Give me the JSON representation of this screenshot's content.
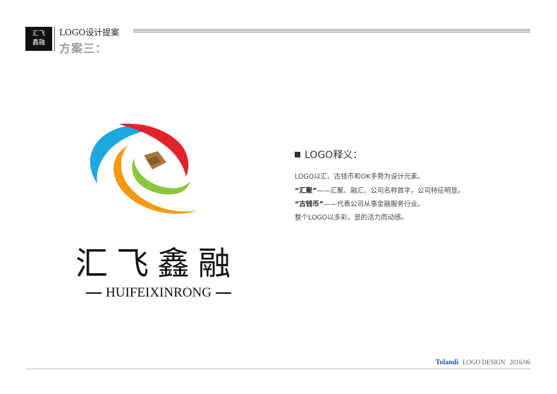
{
  "header": {
    "badge_line1": "汇飞",
    "badge_line2": "鑫融",
    "title": "LOGO设计提案",
    "subtitle": "方案三："
  },
  "logo": {
    "name_cn": "汇飞鑫融",
    "name_en": "HUIFEIXINRONG",
    "colors": {
      "blue": "#1ea7e1",
      "orange": "#f39a12",
      "red": "#e2232b",
      "green": "#8cc63f",
      "coin": "#a9783f"
    }
  },
  "explanation": {
    "title": "LOGO释义：",
    "line1": "LOGO以汇、古钱币和OK手势为设计元素。",
    "line2_bold": "“汇聚”",
    "line2_rest": "——汇聚、融汇、公司名称首字，公司特征明显。",
    "line3_bold": "“古钱币”",
    "line3_rest": "——代表公司从事金融服务行业。",
    "line4": "整个LOGO以多彩，显的活力而动感。"
  },
  "footer": {
    "brand": "Tolandi",
    "text": "LOGO DESIGN",
    "date": "2016/06"
  }
}
